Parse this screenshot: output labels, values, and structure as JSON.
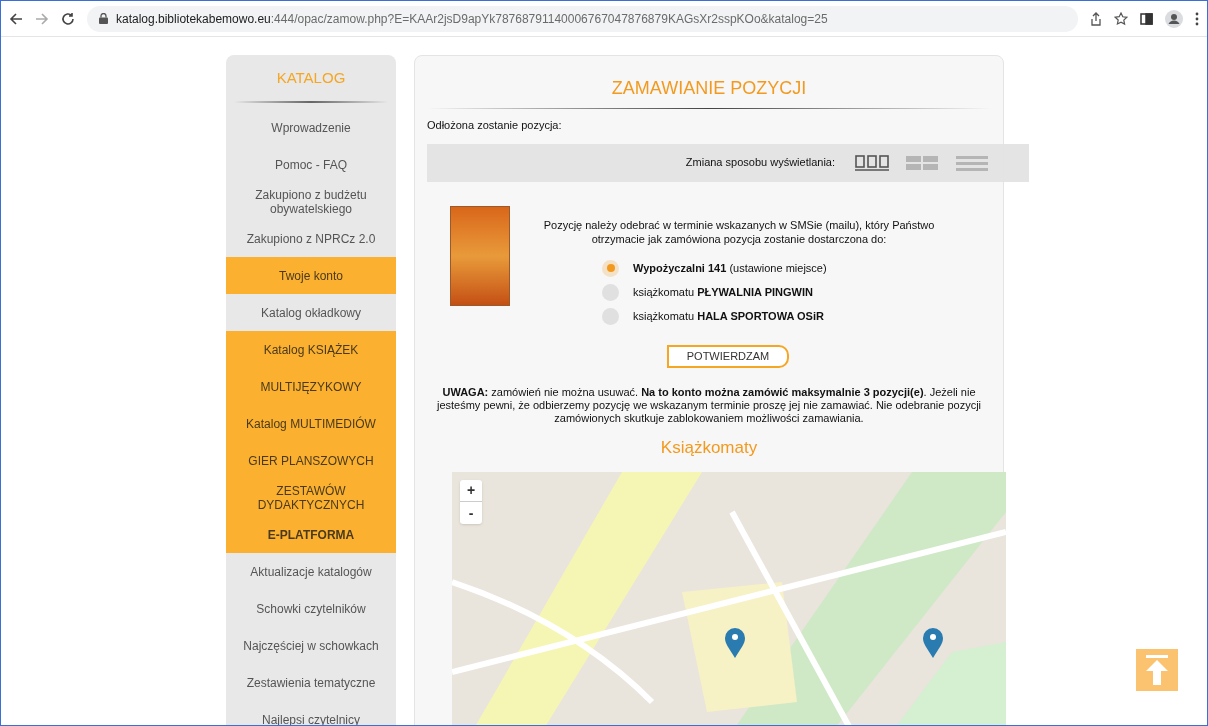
{
  "browser": {
    "url_host": "katalog.bibliotekabemowo.eu",
    "url_rest": ":444/opac/zamow.php?E=KAAr2jsD9apYk78768791140006767047876879KAGsXr2sspKOo&katalog=25"
  },
  "sidebar": {
    "title": "KATALOG",
    "items": [
      {
        "label": "Wprowadzenie",
        "highlighted": false,
        "bold": false
      },
      {
        "label": "Pomoc - FAQ",
        "highlighted": false,
        "bold": false
      },
      {
        "label": "Zakupiono z budżetu obywatelskiego",
        "highlighted": false,
        "bold": false
      },
      {
        "label": "Zakupiono z NPRCz 2.0",
        "highlighted": false,
        "bold": false
      },
      {
        "label": "Twoje konto",
        "highlighted": true,
        "bold": false
      },
      {
        "label": "Katalog okładkowy",
        "highlighted": false,
        "bold": false
      },
      {
        "label": "Katalog KSIĄŻEK",
        "highlighted": true,
        "bold": false
      },
      {
        "label": "MULTIJĘZYKOWY",
        "highlighted": true,
        "bold": false
      },
      {
        "label": "Katalog MULTIMEDIÓW",
        "highlighted": true,
        "bold": false
      },
      {
        "label": "GIER PLANSZOWYCH",
        "highlighted": true,
        "bold": false
      },
      {
        "label": "ZESTAWÓW DYDAKTYCZNYCH",
        "highlighted": true,
        "bold": false
      },
      {
        "label": "E-PLATFORMA",
        "highlighted": true,
        "bold": true
      },
      {
        "label": "Aktualizacje katalogów",
        "highlighted": false,
        "bold": false
      },
      {
        "label": "Schowki czytelników",
        "highlighted": false,
        "bold": false
      },
      {
        "label": "Najczęściej w schowkach",
        "highlighted": false,
        "bold": false
      },
      {
        "label": "Zestawienia tematyczne",
        "highlighted": false,
        "bold": false
      },
      {
        "label": "Najlepsi czytelnicy",
        "highlighted": false,
        "bold": false
      }
    ]
  },
  "main": {
    "title": "ZAMAWIANIE POZYCJI",
    "subtitle": "Odłożona zostanie pozycja:",
    "view_label": "Zmiana sposobu wyświetlania:",
    "view_modes": [
      {
        "kind": "columns",
        "selected": true
      },
      {
        "kind": "tiles",
        "selected": false
      },
      {
        "kind": "list",
        "selected": false
      }
    ],
    "pickup_text": "Pozycję należy odebrać w terminie wskazanych w SMSie (mailu), który Państwo otrzymacie jak zamówiona pozycja zostanie dostarczona do:",
    "pickup_options": [
      {
        "label": "**Wypożyczalni 141** (ustawione miejsce)",
        "selected": true
      },
      {
        "label": "książkomatu **PŁYWALNIA PINGWIN**",
        "selected": false
      },
      {
        "label": "książkomatu **HALA SPORTOWA OSiR**",
        "selected": false
      }
    ],
    "confirm_button": "POTWIERDZAM",
    "notice": "**UWAGA:** zamówień nie można usuwać. **Na to konto można zamówić maksymalnie 3 pozycji(e)**. Jeżeli nie jesteśmy pewni, że odbierzemy pozycję we wskazanym terminie proszę jej nie zamawiać. Nie odebranie pozycji zamówionych skutkuje zablokowaniem możliwości zamawiania.",
    "map_heading": "Książkomaty",
    "map": {
      "zoom_in": "+",
      "zoom_out": "-"
    }
  }
}
